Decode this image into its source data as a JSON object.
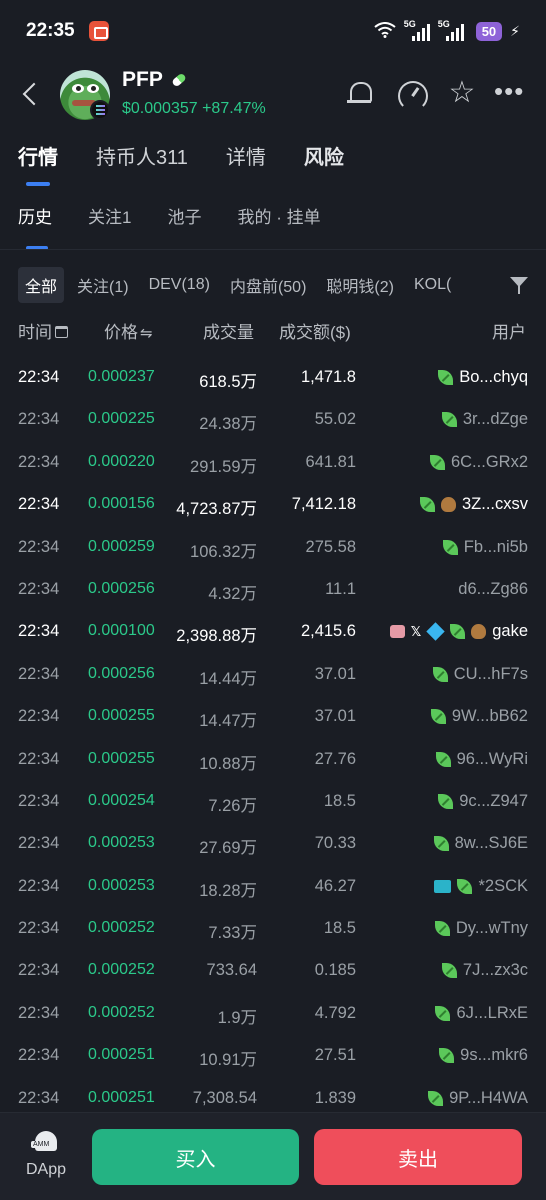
{
  "status": {
    "time": "22:35",
    "net1": "5G",
    "net2": "5G",
    "battery": "50"
  },
  "header": {
    "token": "PFP",
    "price": "$0.000357 +87.47%",
    "colors": {
      "up": "#2bc98a",
      "accent": "#3c7ff2"
    }
  },
  "main_tabs": [
    "行情",
    "持币人311",
    "详情",
    "风险"
  ],
  "sub_tabs": [
    "历史",
    "关注1",
    "池子",
    "我的 · 挂单"
  ],
  "filters": [
    "全部",
    "关注(1)",
    "DEV(18)",
    "内盘前(50)",
    "聪明钱(2)",
    "KOL("
  ],
  "columns": {
    "time": "时间",
    "price": "价格",
    "volume": "成交量",
    "amount": "成交额($)",
    "user": "用户"
  },
  "rows": [
    {
      "time": "22:34",
      "price": "0.000237",
      "volume": "618.5万",
      "amount": "1,471.8",
      "user": "Bo...chyq",
      "icons": [
        "leaf-icon"
      ],
      "highlight": true
    },
    {
      "time": "22:34",
      "price": "0.000225",
      "volume": "24.38万",
      "amount": "55.02",
      "user": "3r...dZge",
      "icons": [
        "leaf-icon"
      ],
      "highlight": false
    },
    {
      "time": "22:34",
      "price": "0.000220",
      "volume": "291.59万",
      "amount": "641.81",
      "user": "6C...GRx2",
      "icons": [
        "leaf-icon"
      ],
      "highlight": false
    },
    {
      "time": "22:34",
      "price": "0.000156",
      "volume": "4,723.87万",
      "amount": "7,412.18",
      "user": "3Z...cxsv",
      "icons": [
        "leaf-icon",
        "bag-icon"
      ],
      "highlight": true
    },
    {
      "time": "22:34",
      "price": "0.000259",
      "volume": "106.32万",
      "amount": "275.58",
      "user": "Fb...ni5b",
      "icons": [
        "leaf-icon"
      ],
      "highlight": false
    },
    {
      "time": "22:34",
      "price": "0.000256",
      "volume": "4.32万",
      "amount": "11.1",
      "user": "d6...Zg86",
      "icons": [],
      "highlight": false
    },
    {
      "time": "22:34",
      "price": "0.000100",
      "volume": "2,398.88万",
      "amount": "2,415.6",
      "user": "gake",
      "icons": [
        "robot-icon",
        "x-icon",
        "diamond-icon",
        "leaf-icon",
        "bag-icon"
      ],
      "highlight": true
    },
    {
      "time": "22:34",
      "price": "0.000256",
      "volume": "14.44万",
      "amount": "37.01",
      "user": "CU...hF7s",
      "icons": [
        "leaf-icon"
      ],
      "highlight": false
    },
    {
      "time": "22:34",
      "price": "0.000255",
      "volume": "14.47万",
      "amount": "37.01",
      "user": "9W...bB62",
      "icons": [
        "leaf-icon"
      ],
      "highlight": false
    },
    {
      "time": "22:34",
      "price": "0.000255",
      "volume": "10.88万",
      "amount": "27.76",
      "user": "96...WyRi",
      "icons": [
        "leaf-icon"
      ],
      "highlight": false
    },
    {
      "time": "22:34",
      "price": "0.000254",
      "volume": "7.26万",
      "amount": "18.5",
      "user": "9c...Z947",
      "icons": [
        "leaf-icon"
      ],
      "highlight": false
    },
    {
      "time": "22:34",
      "price": "0.000253",
      "volume": "27.69万",
      "amount": "70.33",
      "user": "8w...SJ6E",
      "icons": [
        "leaf-icon"
      ],
      "highlight": false
    },
    {
      "time": "22:34",
      "price": "0.000253",
      "volume": "18.28万",
      "amount": "46.27",
      "user": "*2SCK",
      "icons": [
        "card-icon",
        "leaf-icon"
      ],
      "highlight": false
    },
    {
      "time": "22:34",
      "price": "0.000252",
      "volume": "7.33万",
      "amount": "18.5",
      "user": "Dy...wTny",
      "icons": [
        "leaf-icon"
      ],
      "highlight": false
    },
    {
      "time": "22:34",
      "price": "0.000252",
      "volume": "733.64",
      "amount": "0.185",
      "user": "7J...zx3c",
      "icons": [
        "leaf-icon"
      ],
      "highlight": false
    },
    {
      "time": "22:34",
      "price": "0.000252",
      "volume": "1.9万",
      "amount": "4.792",
      "user": "6J...LRxE",
      "icons": [
        "leaf-icon"
      ],
      "highlight": false
    },
    {
      "time": "22:34",
      "price": "0.000251",
      "volume": "10.91万",
      "amount": "27.51",
      "user": "9s...mkr6",
      "icons": [
        "leaf-icon"
      ],
      "highlight": false
    },
    {
      "time": "22:34",
      "price": "0.000251",
      "volume": "7,308.54",
      "amount": "1.839",
      "user": "9P...H4WA",
      "icons": [
        "leaf-icon"
      ],
      "highlight": false
    }
  ],
  "bottom": {
    "dapp_badge": "AMM",
    "dapp_label": "DApp",
    "buy": "买入",
    "sell": "卖出"
  }
}
